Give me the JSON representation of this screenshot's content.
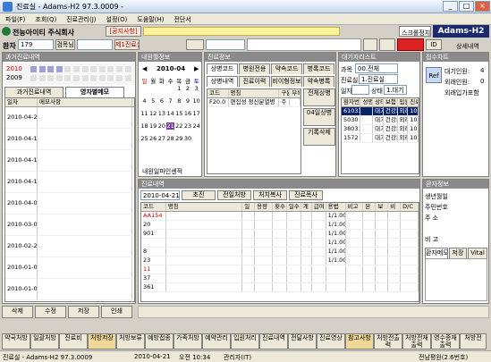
{
  "window": {
    "title": "진료실 - Adams-H2 97.3.0009 -"
  },
  "menu": [
    "파일(F)",
    "조회(Q)",
    "진료관리(J)",
    "설정(O)",
    "도움말(H)",
    "전단서"
  ],
  "company": "전능아이티 주식회사",
  "notice_button": "[공지사항]",
  "product": "Adams-H2",
  "header": {
    "check_label": "스크롤정지",
    "detail_label": "상세내역",
    "reception_list": "제1진료실",
    "chart_no": "179",
    "patient_label": "환자",
    "patient_name": "",
    "exam_button": "검목님",
    "phone": "",
    "id_label": "ID",
    "dept_label": "과목",
    "dept_value": "00.전체",
    "room_label": "진료실",
    "room_value": "1.진료실",
    "day_label": "일자",
    "state_label": "상태",
    "state_value": "1.대기"
  },
  "history": {
    "title": "과거진료내역",
    "tab1": "과거진료내역",
    "tab2": "영자별메모",
    "col1": "일자",
    "col2": "메모사항",
    "rows": [
      {
        "date": "2010-04-21",
        "memo": ""
      },
      {
        "date": "2010-04-16",
        "memo": ""
      },
      {
        "date": "2010-04-14",
        "memo": ""
      },
      {
        "date": "2010-04-14",
        "memo": ""
      },
      {
        "date": "2010-04-05",
        "memo": ""
      },
      {
        "date": "2010-03-02",
        "memo": ""
      },
      {
        "date": "2010-02-25",
        "memo": ""
      },
      {
        "date": "2010-01-07",
        "memo": ""
      },
      {
        "date": "2010-01-05",
        "memo": ""
      }
    ]
  },
  "years": [
    "2010",
    "2009"
  ],
  "calendar": {
    "title": "내원월정보",
    "month": "2010-04",
    "week": [
      "일",
      "월",
      "화",
      "수",
      "목",
      "금",
      "토"
    ],
    "days": [
      "1",
      "2",
      "3",
      "4",
      "5",
      "6",
      "7",
      "8",
      "9",
      "10",
      "11",
      "12",
      "13",
      "14",
      "15",
      "16",
      "17",
      "18",
      "19",
      "20",
      "21",
      "22",
      "23",
      "24",
      "25",
      "26",
      "27",
      "28",
      "29",
      "30"
    ],
    "highlight": "21",
    "visit_label": "내원일마인센적"
  },
  "treat_info": {
    "title": "진료정보",
    "tabs": [
      "상병코드",
      "병원전용",
      "약속코드",
      "병록코드"
    ],
    "sub_tabs": [
      "상병내역",
      "진료이력",
      "비이형정보",
      "약속병록"
    ],
    "col_code": "코드",
    "col_name": "명칭",
    "col_main": "구분",
    "col_etc": "부록",
    "row_code": "F20.0",
    "row_name": "편집성 정신분열병",
    "row_flag": "주",
    "btn1": "전체상병",
    "btn2": "04일상병",
    "btn3": "기록삭제"
  },
  "waiting": {
    "title": "대기자리스트",
    "cols": [
      "환자번호",
      "성명",
      "상태",
      "보험",
      "입원여부",
      "진료시간"
    ],
    "rows": [
      {
        "no": "610316",
        "name": "",
        "state": "대기",
        "ins": "건강보험",
        "inout": "외래",
        "time": "10:25:44",
        "sel": true
      },
      {
        "no": "5030",
        "name": "",
        "state": "대기",
        "ins": "건강보험",
        "inout": "외래",
        "time": "10:35:42",
        "sel": false
      },
      {
        "no": "380310",
        "no2": "",
        "name": "",
        "state": "대기",
        "ins": "건강보험",
        "inout": "외래",
        "time": "10:32:45",
        "sel": false
      },
      {
        "no": "1572",
        "name": "",
        "state": "대기",
        "ins": "건강보험",
        "inout": "외래",
        "time": "10:37:43",
        "sel": false
      }
    ]
  },
  "summary": {
    "title": "접수차트",
    "in_label": "대기인원:",
    "in_count": "4",
    "out_label": "외래인원:",
    "out_count": "0",
    "ref_label": "Ref",
    "check": "외래입가포함"
  },
  "order": {
    "title": "진료내역",
    "date": "2010-04-21",
    "btns": [
      "초진",
      "전일처방",
      "처치복사",
      "진료목사"
    ],
    "cols": [
      "코드",
      "명칭",
      "일",
      "용량",
      "횟수",
      "일수",
      "계",
      "급여",
      "용법",
      "비고",
      "본",
      "보",
      "비",
      "D/C"
    ],
    "rows": [
      {
        "code": "AA154",
        "name": "",
        "cls": "red"
      },
      {
        "code": "20",
        "name": "",
        "cls": ""
      },
      {
        "code": "901",
        "name": "",
        "cls": ""
      },
      {
        "code": "",
        "name": "",
        "cls": ""
      },
      {
        "code": "8",
        "name": "",
        "cls": ""
      },
      {
        "code": "23",
        "name": "",
        "cls": ""
      },
      {
        "code": "11",
        "name": "",
        "cls": "red"
      },
      {
        "code": "37",
        "name": "",
        "cls": ""
      },
      {
        "code": "361",
        "name": "",
        "cls": ""
      }
    ],
    "dose": [
      "1/1.00",
      "1/1.00",
      "1/1.00",
      "1/1.00",
      "1/1.00",
      "1/1.00"
    ]
  },
  "patient": {
    "title": "환자정보",
    "birth_label": "생년월일",
    "id_label": "주민번호",
    "addr_label": "주 소",
    "memo_label": "비 고",
    "tab_memo": "환자메모",
    "tab_save": "저장",
    "tab_vital": "Vital",
    "memo": ""
  },
  "bottom": [
    "약국처방",
    "일괄처방",
    "진료비",
    "처방저장",
    "처방보류",
    "예방접종",
    "가족처방",
    "예약관리",
    "입원처리",
    "진료내역",
    "전달사항",
    "진료영상",
    "참고사항",
    "처방전출력",
    "처방전재출력",
    "영수증재출력",
    "처방전"
  ],
  "mid_btns": [
    "삭제",
    "수정",
    "저장",
    "인쇄"
  ],
  "status": {
    "left": "진료실 - Adams-H2 97.3.0009",
    "date": "2010-04-21",
    "time": "오전 10:34",
    "user": "관리자(IT)",
    "right": "전남평원(2.6번호)"
  }
}
